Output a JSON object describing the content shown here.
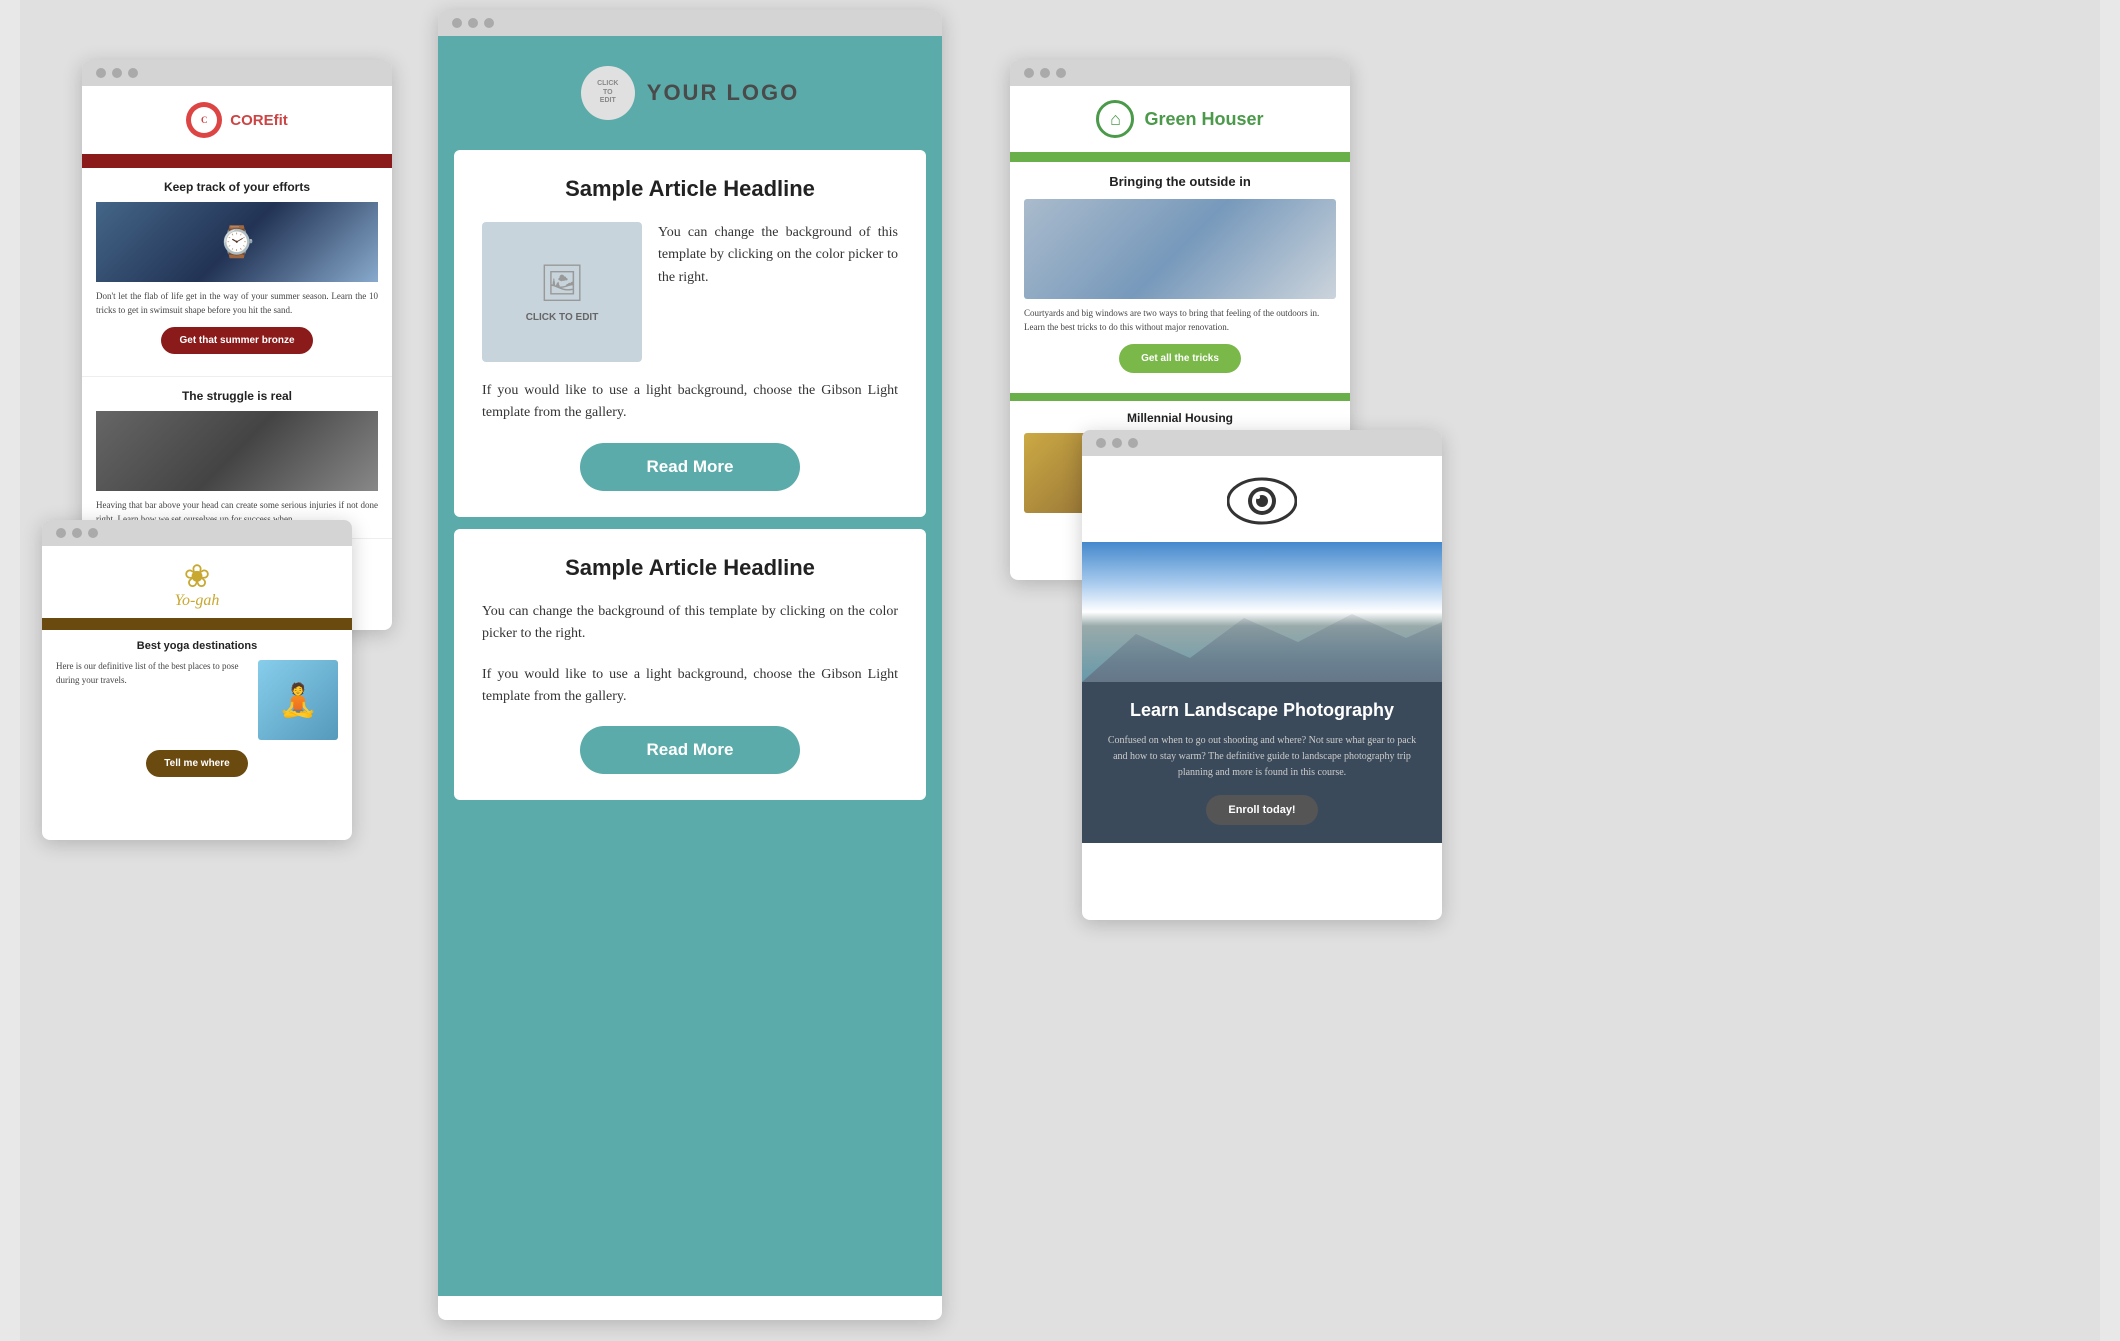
{
  "scene": {
    "background": "#e0e0e0"
  },
  "main_window": {
    "logo": {
      "click_to_edit": "CLICK\nTO\nEDIT",
      "text": "YOUR LOGO"
    },
    "article1": {
      "headline": "Sample Article Headline",
      "image_label": "CLICK TO EDIT",
      "body1": "You can change the background of this template by clicking on the color picker to the right.",
      "body2": "If you would like to use a light background, choose the Gibson Light template from the gallery.",
      "read_more": "Read More"
    },
    "article2": {
      "headline": "Sample Article Headline",
      "body1": "You can change the background of this template by clicking on the color picker to the right.",
      "body2": "If you would like to use a light background, choose the Gibson Light template from the gallery.",
      "read_more": "Read More"
    }
  },
  "corefit_window": {
    "brand": "COREfit",
    "brand_prefix": "CORE",
    "brand_suffix": "fit",
    "card1": {
      "title": "Keep track of your efforts",
      "body": "Don't let the flab of life get in the way of your summer season. Learn the 10 tricks to get in swimsuit shape before you hit the sand.",
      "cta": "Get that summer bronze"
    },
    "card2": {
      "title": "The struggle is real",
      "body": "Heaving that bar above your head can create some serious injuries if not done right. Learn how we set ourselves up for success when..."
    }
  },
  "yogah_window": {
    "brand": "Yo-gah",
    "lotus_symbol": "✿",
    "card": {
      "title": "Best yoga destinations",
      "body": "Here is our definitive list of the best places to pose during your travels.",
      "cta": "Tell me where"
    }
  },
  "green_houser_window": {
    "brand": "Green Houser",
    "card1": {
      "title": "Bringing the outside in",
      "body": "Courtyards and big windows are two ways to bring that feeling of the outdoors in. Learn the best tricks to do this without major renovation.",
      "cta": "Get all the tricks"
    },
    "card2": {
      "title": "Millennial Housing"
    }
  },
  "landscape_window": {
    "camera_icon": "👁",
    "card": {
      "title": "Learn Landscape Photography",
      "body": "Confused on when to go out shooting and where? Not sure what gear to pack and how to stay warm? The definitive guide to landscape photography trip planning and more is found in this course.",
      "cta": "Enroll today!"
    }
  }
}
